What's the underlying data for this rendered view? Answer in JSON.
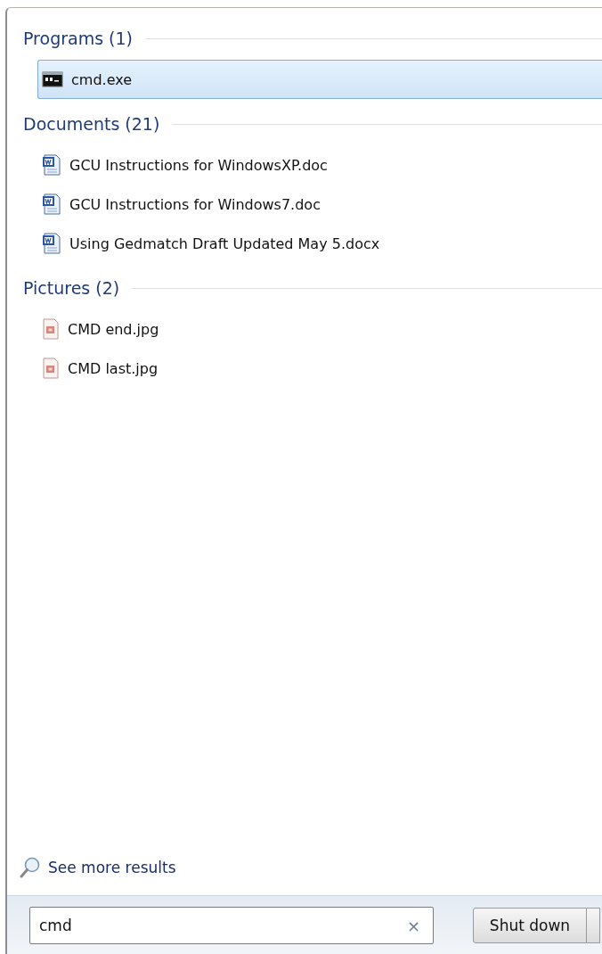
{
  "sections": [
    {
      "title": "Programs (1)",
      "items": [
        {
          "label": "cmd.exe",
          "kind": "console",
          "selected": true
        }
      ]
    },
    {
      "title": "Documents (21)",
      "items": [
        {
          "label": "GCU Instructions for WindowsXP.doc",
          "kind": "document",
          "selected": false
        },
        {
          "label": "GCU Instructions for Windows7.doc",
          "kind": "document",
          "selected": false
        },
        {
          "label": "Using Gedmatch Draft Updated May 5.docx",
          "kind": "document",
          "selected": false
        }
      ]
    },
    {
      "title": "Pictures (2)",
      "items": [
        {
          "label": "CMD end.jpg",
          "kind": "image",
          "selected": false
        },
        {
          "label": "CMD last.jpg",
          "kind": "image",
          "selected": false
        }
      ]
    }
  ],
  "see_more": "See more results",
  "search": {
    "value": "cmd",
    "clear": "×"
  },
  "shutdown": "Shut down"
}
